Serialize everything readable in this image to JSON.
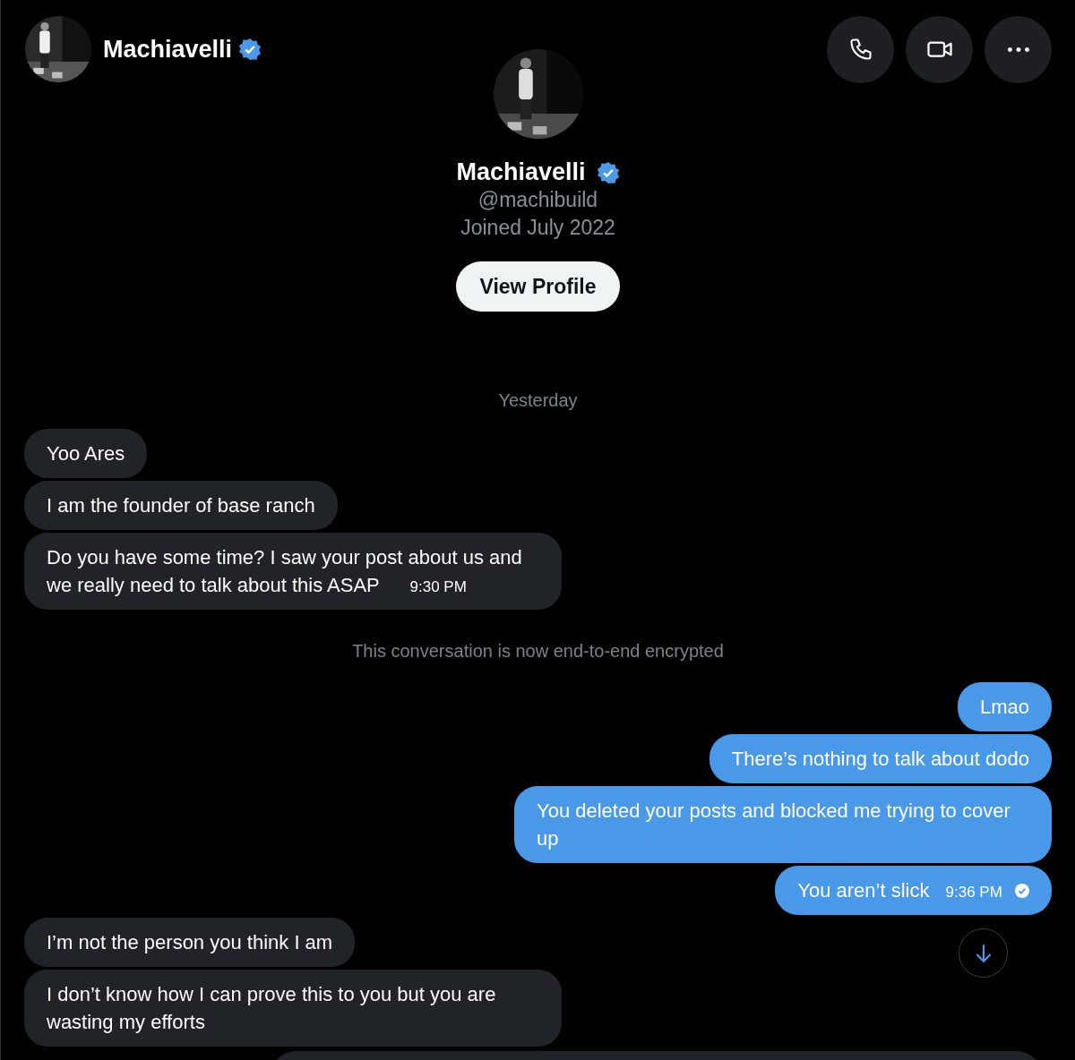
{
  "header": {
    "name": "Machiavelli",
    "verified": true
  },
  "profile": {
    "name": "Machiavelli",
    "verified": true,
    "handle": "@machibuild",
    "joined": "Joined July 2022",
    "button": "View Profile"
  },
  "date_divider": "Yesterday",
  "messages": [
    {
      "kind": "received",
      "text": "Yoo Ares"
    },
    {
      "kind": "received",
      "text": "I am the founder of base ranch"
    },
    {
      "kind": "received",
      "text": "Do you have some time? I saw your post about us and we really need to talk about this ASAP",
      "time": "9:30 PM"
    },
    {
      "kind": "notice",
      "text": "This conversation is now end-to-end encrypted"
    },
    {
      "kind": "sent",
      "text": "Lmao"
    },
    {
      "kind": "sent",
      "text": "There’s nothing to talk about dodo"
    },
    {
      "kind": "sent",
      "text": "You deleted your posts and blocked me trying to cover up"
    },
    {
      "kind": "sent",
      "text": "You aren’t slick",
      "time": "9:36 PM",
      "read": true
    },
    {
      "kind": "received",
      "text": "I’m not the person you think I am"
    },
    {
      "kind": "received",
      "text": "I don’t know how I can prove this to you but you are wasting my efforts"
    }
  ]
}
